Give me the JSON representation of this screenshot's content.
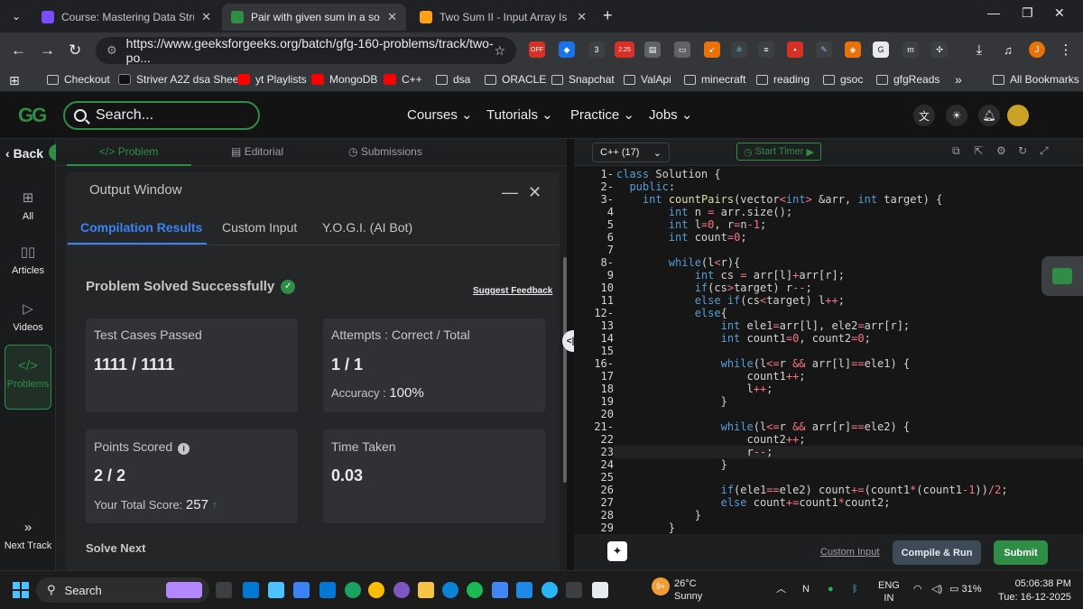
{
  "browser": {
    "tabs": [
      {
        "title": "Course: Mastering Data Structu",
        "color": "#7c4dff"
      },
      {
        "title": "Pair with given sum in a sorted",
        "color": "#2f8d46"
      },
      {
        "title": "Two Sum II - Input Array Is Sort",
        "color": "#ffa116"
      }
    ],
    "url": "https://www.geeksforgeeks.org/batch/gfg-160-problems/track/two-po...",
    "profile_initial": "J",
    "ext_badges": {
      "off": "OFF",
      "three": "3",
      "price": "2.25"
    },
    "bookmarks": [
      "Checkout",
      "Striver A2Z dsa Sheet",
      "yt Playlists",
      "MongoDB",
      "C++",
      "dsa",
      "ORACLE",
      "Snapchat",
      "ValApi",
      "minecraft",
      "reading",
      "gsoc",
      "gfgReads"
    ],
    "bookmarks_overflow": "»",
    "all_bookmarks": "All Bookmarks"
  },
  "header": {
    "logo": "GG",
    "search_placeholder": "Search...",
    "nav": [
      "Courses",
      "Tutorials",
      "Practice",
      "Jobs"
    ]
  },
  "rail": {
    "back": "Back",
    "items": [
      "All",
      "Articles",
      "Videos",
      "Problems"
    ],
    "next_track": "Next Track"
  },
  "problem_tabs": [
    "Problem",
    "Editorial",
    "Submissions"
  ],
  "output": {
    "title": "Output Window",
    "tabs": [
      "Compilation Results",
      "Custom Input",
      "Y.O.G.I. (AI Bot)"
    ],
    "status": "Problem Solved Successfully",
    "feedback": "Suggest Feedback",
    "test_cases_label": "Test Cases Passed",
    "test_cases_value": "1111 / 1111",
    "attempts_label": "Attempts : Correct / Total",
    "attempts_value": "1 / 1",
    "accuracy_label": "Accuracy :",
    "accuracy_value": "100%",
    "points_label": "Points Scored",
    "points_value": "2 / 2",
    "total_score_label": "Your Total Score:",
    "total_score_value": "257",
    "time_label": "Time Taken",
    "time_value": "0.03",
    "solve_next": "Solve Next"
  },
  "editor": {
    "language": "C++ (17)",
    "timer": "Start Timer",
    "custom_input": "Custom Input",
    "compile": "Compile & Run",
    "submit": "Submit"
  },
  "taskbar": {
    "search": "Search",
    "weather_badge": "9+",
    "temp": "26°C",
    "condition": "Sunny",
    "lang": "ENG",
    "region": "IN",
    "battery": "31%",
    "time": "05:06:38 PM",
    "date": "Tue: 16-12-2025"
  },
  "colors": {
    "brand": "#2f8d46",
    "link": "#3b82f6"
  }
}
